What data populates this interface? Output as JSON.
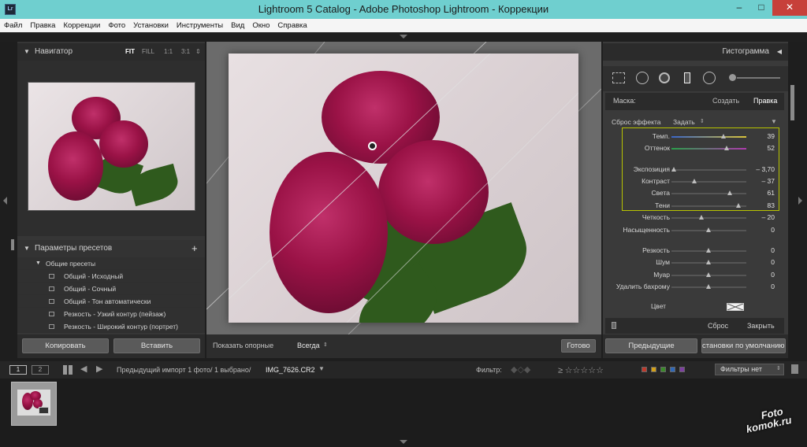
{
  "titlebar": {
    "icon_text": "Lr",
    "title": "Lightroom 5 Catalog - Adobe Photoshop Lightroom - Коррекции",
    "minimize": "–",
    "maximize": "□",
    "close": "✕"
  },
  "menu": [
    "Файл",
    "Правка",
    "Коррекции",
    "Фото",
    "Установки",
    "Инструменты",
    "Вид",
    "Окно",
    "Справка"
  ],
  "navigator": {
    "title": "Навигатор",
    "zoom_options": [
      "FIT",
      "FILL",
      "1:1",
      "3:1"
    ]
  },
  "presets": {
    "title": "Параметры пресетов",
    "add": "+",
    "group": "Общие пресеты",
    "items": [
      "Общий - Исходный",
      "Общий - Сочный",
      "Общий - Тон автоматически",
      "Резкость - Узкий контур (пейзаж)",
      "Резкость - Широкий контур (портрет)"
    ]
  },
  "left_buttons": {
    "copy": "Копировать",
    "paste": "Вставить"
  },
  "center_toolbar": {
    "show_pins_label": "Показать опорные",
    "show_pins_value": "Всегда",
    "done": "Готово"
  },
  "histogram": {
    "title": "Гистограмма"
  },
  "mask": {
    "label": "Маска:",
    "create": "Создать",
    "edit": "Правка"
  },
  "effect": {
    "reset": "Сброс эффекта",
    "set": "Задать"
  },
  "sliders": [
    {
      "label": "Темп.",
      "value": "39",
      "pos": 0.7
    },
    {
      "label": "Оттенок",
      "value": "52",
      "pos": 0.74
    },
    {
      "label": "Экспозиция",
      "value": "– 3,70",
      "pos": 0.04
    },
    {
      "label": "Контраст",
      "value": "– 37",
      "pos": 0.31
    },
    {
      "label": "Света",
      "value": "61",
      "pos": 0.78
    },
    {
      "label": "Тени",
      "value": "83",
      "pos": 0.9
    },
    {
      "label": "Четкость",
      "value": "– 20",
      "pos": 0.4
    },
    {
      "label": "Насыщенность",
      "value": "0",
      "pos": 0.5
    },
    {
      "label": "Резкость",
      "value": "0",
      "pos": 0.5
    },
    {
      "label": "Шум",
      "value": "0",
      "pos": 0.5
    },
    {
      "label": "Муар",
      "value": "0",
      "pos": 0.5
    },
    {
      "label": "Удалить бахрому",
      "value": "0",
      "pos": 0.5
    }
  ],
  "color": {
    "label": "Цвет"
  },
  "panel_footer": {
    "reset": "Сброс",
    "close": "Закрыть"
  },
  "right_buttons": {
    "previous": "Предыдущие",
    "defaults": "становки по умолчанию..."
  },
  "filmstrip_bar": {
    "view1": "1",
    "view2": "2",
    "source": "Предыдущий импорт  1 фото/  1 выбрано/",
    "filename": "IMG_7626.CR2",
    "filter_label": "Фильтр:",
    "filter_value": "Фильтры нет",
    "color_labels": [
      "#c0392b",
      "#d4a017",
      "#3a8a2a",
      "#2f68b8",
      "#7d3fa0"
    ]
  },
  "watermark": {
    "line1": "Foto",
    "line2": "komok.ru"
  }
}
